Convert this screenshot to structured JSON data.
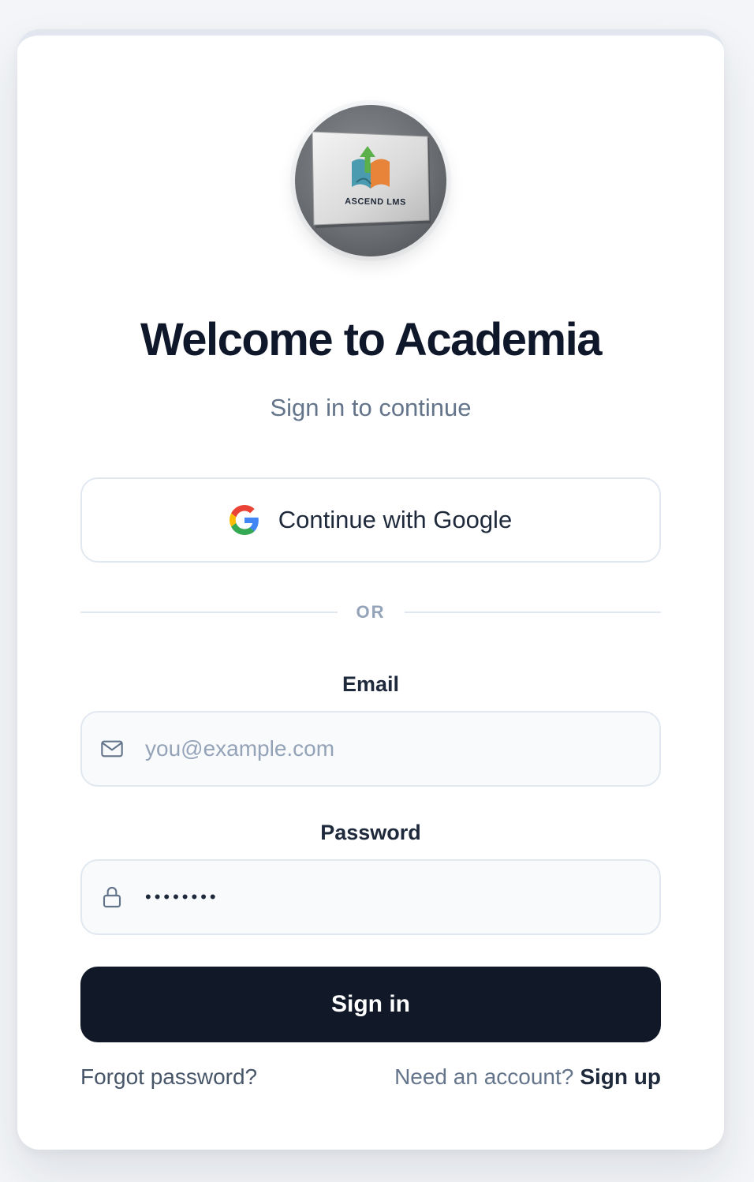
{
  "logo": {
    "text": "ASCEND LMS"
  },
  "header": {
    "title": "Welcome to Academia",
    "subtitle": "Sign in to continue"
  },
  "google_button": {
    "label": "Continue with Google",
    "icon": "google-icon"
  },
  "divider": {
    "label": "OR"
  },
  "email": {
    "label": "Email",
    "placeholder": "you@example.com",
    "value": "",
    "icon": "mail-icon"
  },
  "password": {
    "label": "Password",
    "value": "password",
    "icon": "lock-icon"
  },
  "signin_button": {
    "label": "Sign in"
  },
  "footer": {
    "forgot_label": "Forgot password?",
    "need_account_label": "Need an account?",
    "signup_label": "Sign up"
  },
  "colors": {
    "primary_button": "#111827",
    "title": "#0f172a",
    "muted": "#64748b",
    "border": "#e2e8f0"
  }
}
